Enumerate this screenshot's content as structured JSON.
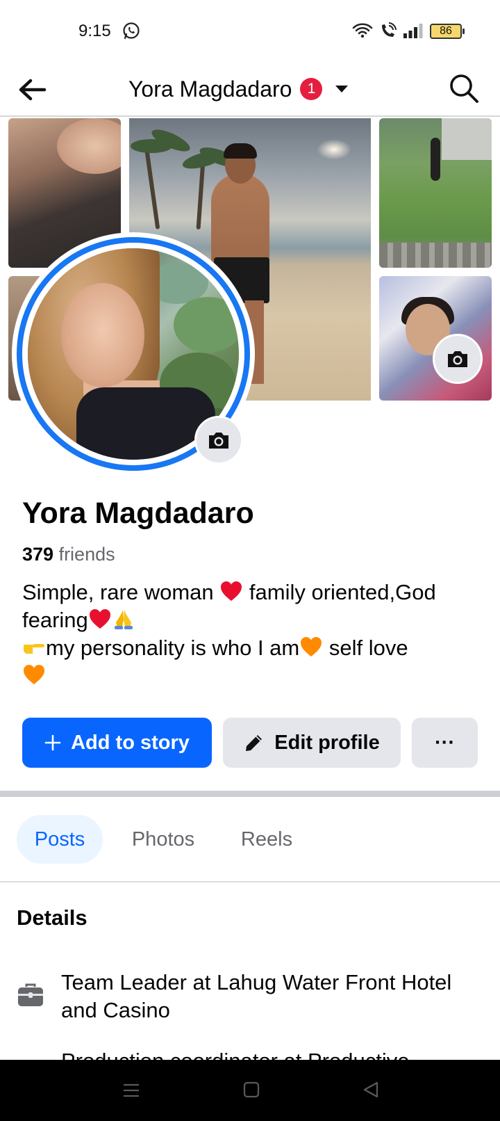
{
  "status_bar": {
    "time": "9:15",
    "battery": "86"
  },
  "header": {
    "title": "Yora Magdadaro",
    "notification_count": "1"
  },
  "profile": {
    "name": "Yora Magdadaro",
    "friends_count": "379",
    "friends_label": " friends",
    "bio": {
      "line1": "Simple, rare woman ",
      "line1b": " family oriented,God",
      "line2": "fearing",
      "line3": "my personality is who I am",
      "line3b": " self love"
    }
  },
  "actions": {
    "add_to_story": "Add to story",
    "edit_profile": "Edit profile",
    "more": "···"
  },
  "tabs": [
    {
      "label": "Posts",
      "active": true
    },
    {
      "label": "Photos",
      "active": false
    },
    {
      "label": "Reels",
      "active": false
    }
  ],
  "details": {
    "heading": "Details",
    "items": [
      {
        "icon": "briefcase-icon",
        "text": "Team Leader at Lahug Water Front Hotel and Casino"
      },
      {
        "icon": "",
        "text": "Production coordinator at Productive"
      }
    ]
  },
  "colors": {
    "accent": "#0866ff",
    "ring": "#1877f2",
    "badge": "#e41e3f",
    "button_gray": "#e4e6eb",
    "tab_active_bg": "#ebf5ff"
  }
}
